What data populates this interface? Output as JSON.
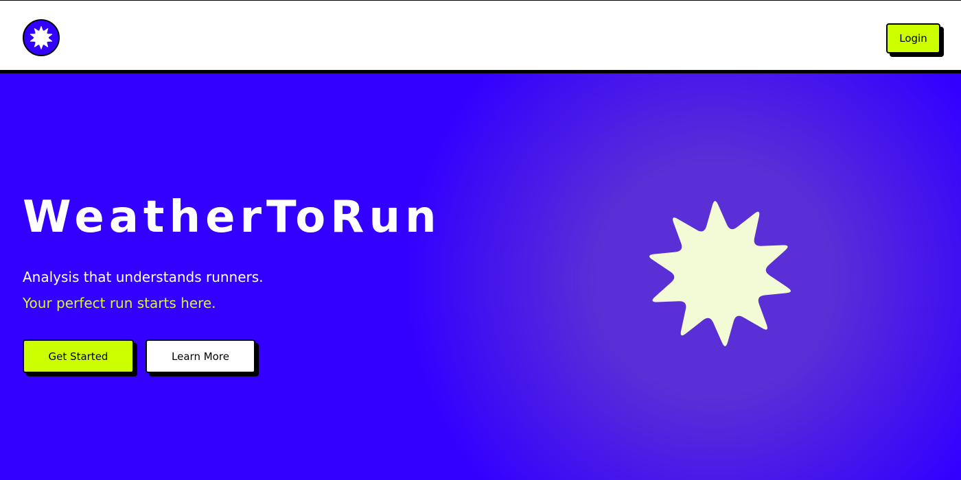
{
  "header": {
    "logo_icon": "asterisk-flower-icon",
    "login_label": "Login"
  },
  "hero": {
    "title": "WeatherToRun",
    "subtitle": "Analysis that understands runners.",
    "tagline": "Your perfect run starts here.",
    "get_started_label": "Get Started",
    "learn_more_label": "Learn More",
    "graphic_icon": "asterisk-flower-icon"
  },
  "colors": {
    "primary_blue": "#3300ff",
    "glow_purple": "#5a2fd6",
    "accent_lime": "#ccff00",
    "tagline_lime": "#d4f53c",
    "flower_cream": "#f2fbd6",
    "white": "#ffffff",
    "black": "#000000"
  }
}
